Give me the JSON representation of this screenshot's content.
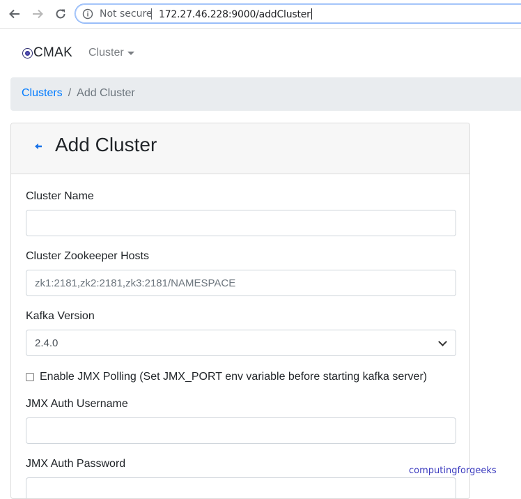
{
  "browser": {
    "security_label": "Not secure",
    "url": "172.27.46.228:9000/addCluster"
  },
  "navbar": {
    "brand": "CMAK",
    "cluster_menu": "Cluster"
  },
  "breadcrumb": {
    "parent": "Clusters",
    "separator": "/",
    "current": "Add Cluster"
  },
  "card": {
    "title": "Add Cluster"
  },
  "form": {
    "cluster_name": {
      "label": "Cluster Name",
      "value": ""
    },
    "zk_hosts": {
      "label": "Cluster Zookeeper Hosts",
      "placeholder": "zk1:2181,zk2:2181,zk3:2181/NAMESPACE"
    },
    "kafka_version": {
      "label": "Kafka Version",
      "value": "2.4.0"
    },
    "jmx_polling": {
      "label": "Enable JMX Polling (Set JMX_PORT env variable before starting kafka server)",
      "checked": false
    },
    "jmx_user": {
      "label": "JMX Auth Username",
      "value": ""
    },
    "jmx_password": {
      "label": "JMX Auth Password",
      "value": ""
    }
  },
  "watermark": "computingforgeeks",
  "colors": {
    "link": "#007bff",
    "breadcrumb_bg": "#e9ecef",
    "omnibox_focus": "#8ab4f8"
  }
}
